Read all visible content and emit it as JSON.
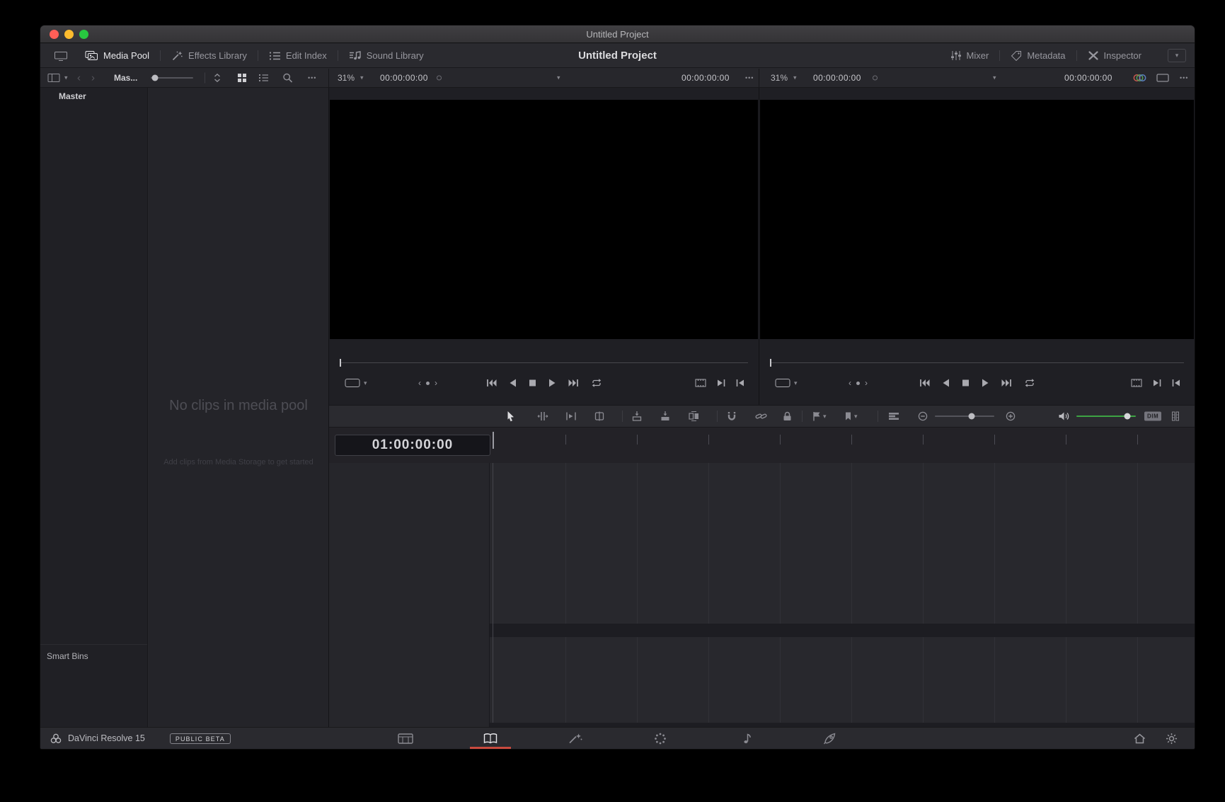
{
  "titlebar": {
    "title": "Untitled Project"
  },
  "icons": {
    "chevron_down": "▾",
    "back": "‹",
    "forward": "›",
    "more": "•••"
  },
  "toolbar": {
    "left": [
      {
        "label": "Media Pool",
        "active": true
      },
      {
        "label": "Effects Library",
        "active": false
      },
      {
        "label": "Edit Index",
        "active": false
      },
      {
        "label": "Sound Library",
        "active": false
      }
    ],
    "project_title": "Untitled Project",
    "right": [
      {
        "label": "Mixer"
      },
      {
        "label": "Metadata"
      },
      {
        "label": "Inspector"
      }
    ]
  },
  "media_pool": {
    "current_bin_truncated": "Mas...",
    "root_bin": "Master",
    "smart_bins": "Smart Bins",
    "empty_title": "No clips in media pool",
    "empty_hint": "Add clips from Media Storage to get started"
  },
  "source_viewer": {
    "zoom": "31%",
    "timecode": "00:00:00:00",
    "duration_timecode": "00:00:00:00"
  },
  "timeline_viewer": {
    "zoom": "31%",
    "timecode": "00:00:00:00",
    "duration_timecode": "00:00:00:00"
  },
  "timeline": {
    "ruler_timecode": "01:00:00:00",
    "dim_label": "DIM"
  },
  "statusbar": {
    "app_name": "DaVinci Resolve 15",
    "badge": "PUBLIC BETA",
    "pages": [
      "media",
      "edit",
      "fusion",
      "color",
      "fairlight",
      "deliver"
    ],
    "active_page": "edit"
  },
  "colors": {
    "accent_red": "#c94a3f",
    "audio_green": "#3da343"
  }
}
